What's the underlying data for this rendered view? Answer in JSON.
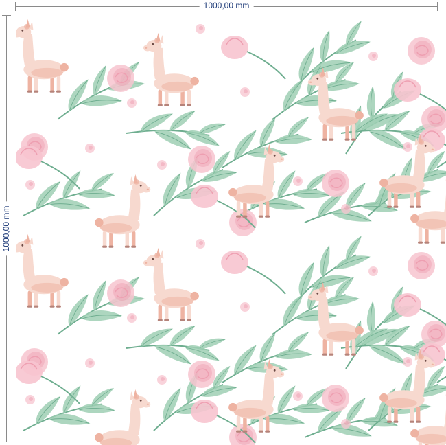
{
  "dimensions": {
    "width_label": "1000,00 mm",
    "height_label": "1000,00 mm"
  },
  "pattern": {
    "motif": "llama",
    "colors": {
      "llama_body": "#f7d9cf",
      "llama_shade": "#eeb3a2",
      "leaf": "#9fcfb4",
      "leaf_dark": "#6fae90",
      "rose": "#f7c4cf",
      "rose_dark": "#ee9fb1"
    }
  }
}
